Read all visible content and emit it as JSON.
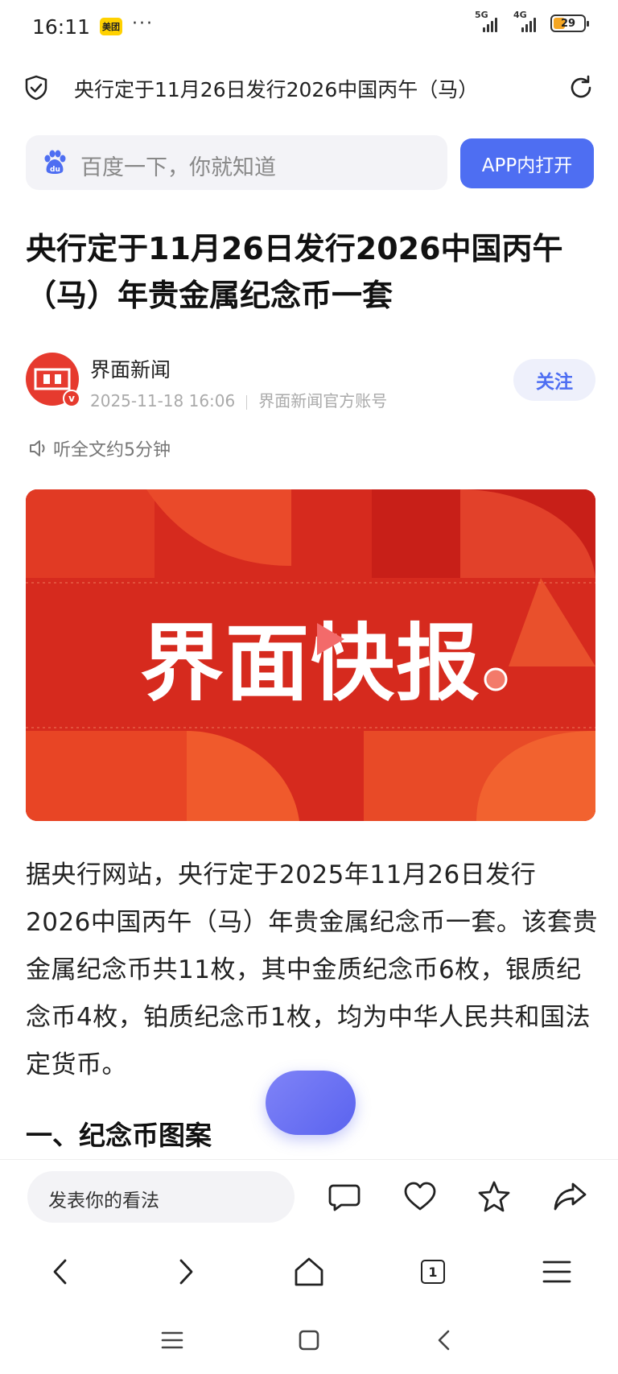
{
  "status_bar": {
    "time": "16:11",
    "app_badge": "美团",
    "more": "···",
    "network_1": "5G",
    "network_2": "4G",
    "battery": "29"
  },
  "url_bar": {
    "title": "央行定于11月26日发行2026中国丙午（马）"
  },
  "search": {
    "placeholder": "百度一下，你就知道",
    "app_button": "APP内打开"
  },
  "article": {
    "title": "央行定于11月26日发行2026中国丙午（马）年贵金属纪念币一套",
    "author": {
      "name": "界面新闻",
      "date": "2025-11-18 16:06",
      "account_type": "界面新闻官方账号",
      "follow_label": "关注"
    },
    "listen_label": "听全文约5分钟",
    "banner_text": "界面快报",
    "body": "据央行网站，央行定于2025年11月26日发行2026中国丙午（马）年贵金属纪念币一套。该套贵金属纪念币共11枚，其中金质纪念币6枚，银质纪念币4枚，铂质纪念币1枚，均为中华人民共和国法定货币。",
    "section_heading": "一、纪念币图案"
  },
  "comment_bar": {
    "placeholder": "发表你的看法"
  },
  "browser_nav": {
    "tab_count": "1"
  },
  "colors": {
    "accent": "#4e6ef2",
    "brand_red": "#e63a2e",
    "banner_red": "#d9261c"
  }
}
